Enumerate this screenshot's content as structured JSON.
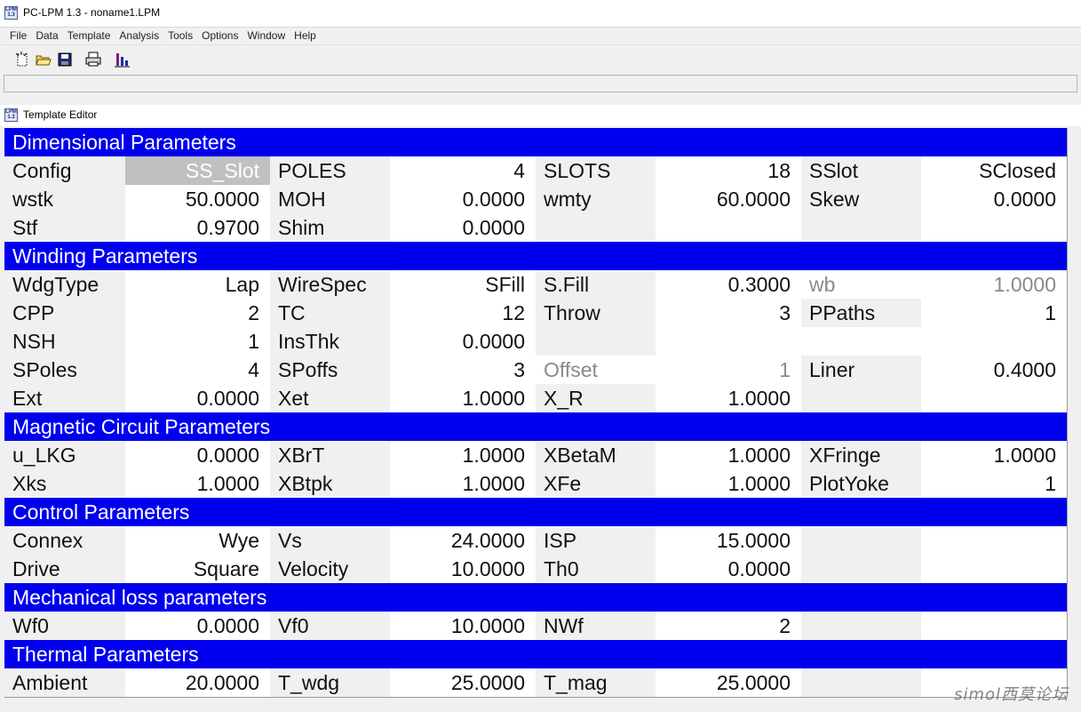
{
  "app": {
    "title": "PC-LPM 1.3 - noname1.LPM",
    "icon_label": "LPM 1.3",
    "menu": [
      "File",
      "Data",
      "Template",
      "Analysis",
      "Tools",
      "Options",
      "Window",
      "Help"
    ],
    "toolbar": {
      "icons": [
        "new-document-icon",
        "open-folder-icon",
        "save-disk-icon",
        "print-icon",
        "chart-icon"
      ]
    }
  },
  "child_window": {
    "title": "Template Editor"
  },
  "sections": {
    "dimensional": {
      "title": "Dimensional Parameters",
      "rows": [
        [
          [
            "Config",
            "SS_Slot"
          ],
          [
            "POLES",
            "4"
          ],
          [
            "SLOTS",
            "18"
          ],
          [
            "SSlot",
            "SClosed"
          ]
        ],
        [
          [
            "wstk",
            "50.0000"
          ],
          [
            "MOH",
            "0.0000"
          ],
          [
            "wmty",
            "60.0000"
          ],
          [
            "Skew",
            "0.0000"
          ]
        ],
        [
          [
            "Stf",
            "0.9700"
          ],
          [
            "Shim",
            "0.0000"
          ],
          [
            "",
            ""
          ],
          [
            "",
            ""
          ]
        ]
      ]
    },
    "winding": {
      "title": "Winding Parameters",
      "rows": [
        [
          [
            "WdgType",
            "Lap"
          ],
          [
            "WireSpec",
            "SFill"
          ],
          [
            "S.Fill",
            "0.3000"
          ],
          [
            "wb",
            "1.0000"
          ]
        ],
        [
          [
            "CPP",
            "2"
          ],
          [
            "TC",
            "12"
          ],
          [
            "Throw",
            "3"
          ],
          [
            "PPaths",
            "1"
          ]
        ],
        [
          [
            "NSH",
            "1"
          ],
          [
            "InsThk",
            "0.0000"
          ],
          [
            "",
            ""
          ],
          [
            "",
            ""
          ]
        ],
        [
          [
            "SPoles",
            "4"
          ],
          [
            "SPoffs",
            "3"
          ],
          [
            "Offset",
            "1"
          ],
          [
            "Liner",
            "0.4000"
          ]
        ],
        [
          [
            "Ext",
            "0.0000"
          ],
          [
            "Xet",
            "1.0000"
          ],
          [
            "X_R",
            "1.0000"
          ],
          [
            "",
            ""
          ]
        ]
      ]
    },
    "magnetic": {
      "title": "Magnetic Circuit Parameters",
      "rows": [
        [
          [
            "u_LKG",
            "0.0000"
          ],
          [
            "XBrT",
            "1.0000"
          ],
          [
            "XBetaM",
            "1.0000"
          ],
          [
            "XFringe",
            "1.0000"
          ]
        ],
        [
          [
            "Xks",
            "1.0000"
          ],
          [
            "XBtpk",
            "1.0000"
          ],
          [
            "XFe",
            "1.0000"
          ],
          [
            "PlotYoke",
            "1"
          ]
        ]
      ]
    },
    "control": {
      "title": "Control Parameters",
      "rows": [
        [
          [
            "Connex",
            "Wye"
          ],
          [
            "Vs",
            "24.0000"
          ],
          [
            "ISP",
            "15.0000"
          ],
          [
            "",
            ""
          ]
        ],
        [
          [
            "Drive",
            "Square"
          ],
          [
            "Velocity",
            "10.0000"
          ],
          [
            "Th0",
            "0.0000"
          ],
          [
            "",
            ""
          ]
        ]
      ]
    },
    "mechanical": {
      "title": "Mechanical loss parameters",
      "rows": [
        [
          [
            "Wf0",
            "0.0000"
          ],
          [
            "Vf0",
            "10.0000"
          ],
          [
            "NWf",
            "2"
          ],
          [
            "",
            ""
          ]
        ]
      ]
    },
    "thermal": {
      "title": "Thermal Parameters",
      "rows": [
        [
          [
            "Ambient",
            "20.0000"
          ],
          [
            "T_wdg",
            "25.0000"
          ],
          [
            "T_mag",
            "25.0000"
          ],
          [
            "",
            ""
          ]
        ]
      ]
    }
  },
  "watermark": "simol西莫论坛",
  "colors": {
    "section_header": "#0000ee",
    "label_bg": "#f0f0f0",
    "selected_bg": "#c0c0c0",
    "disabled_text": "#8a8a8a"
  }
}
